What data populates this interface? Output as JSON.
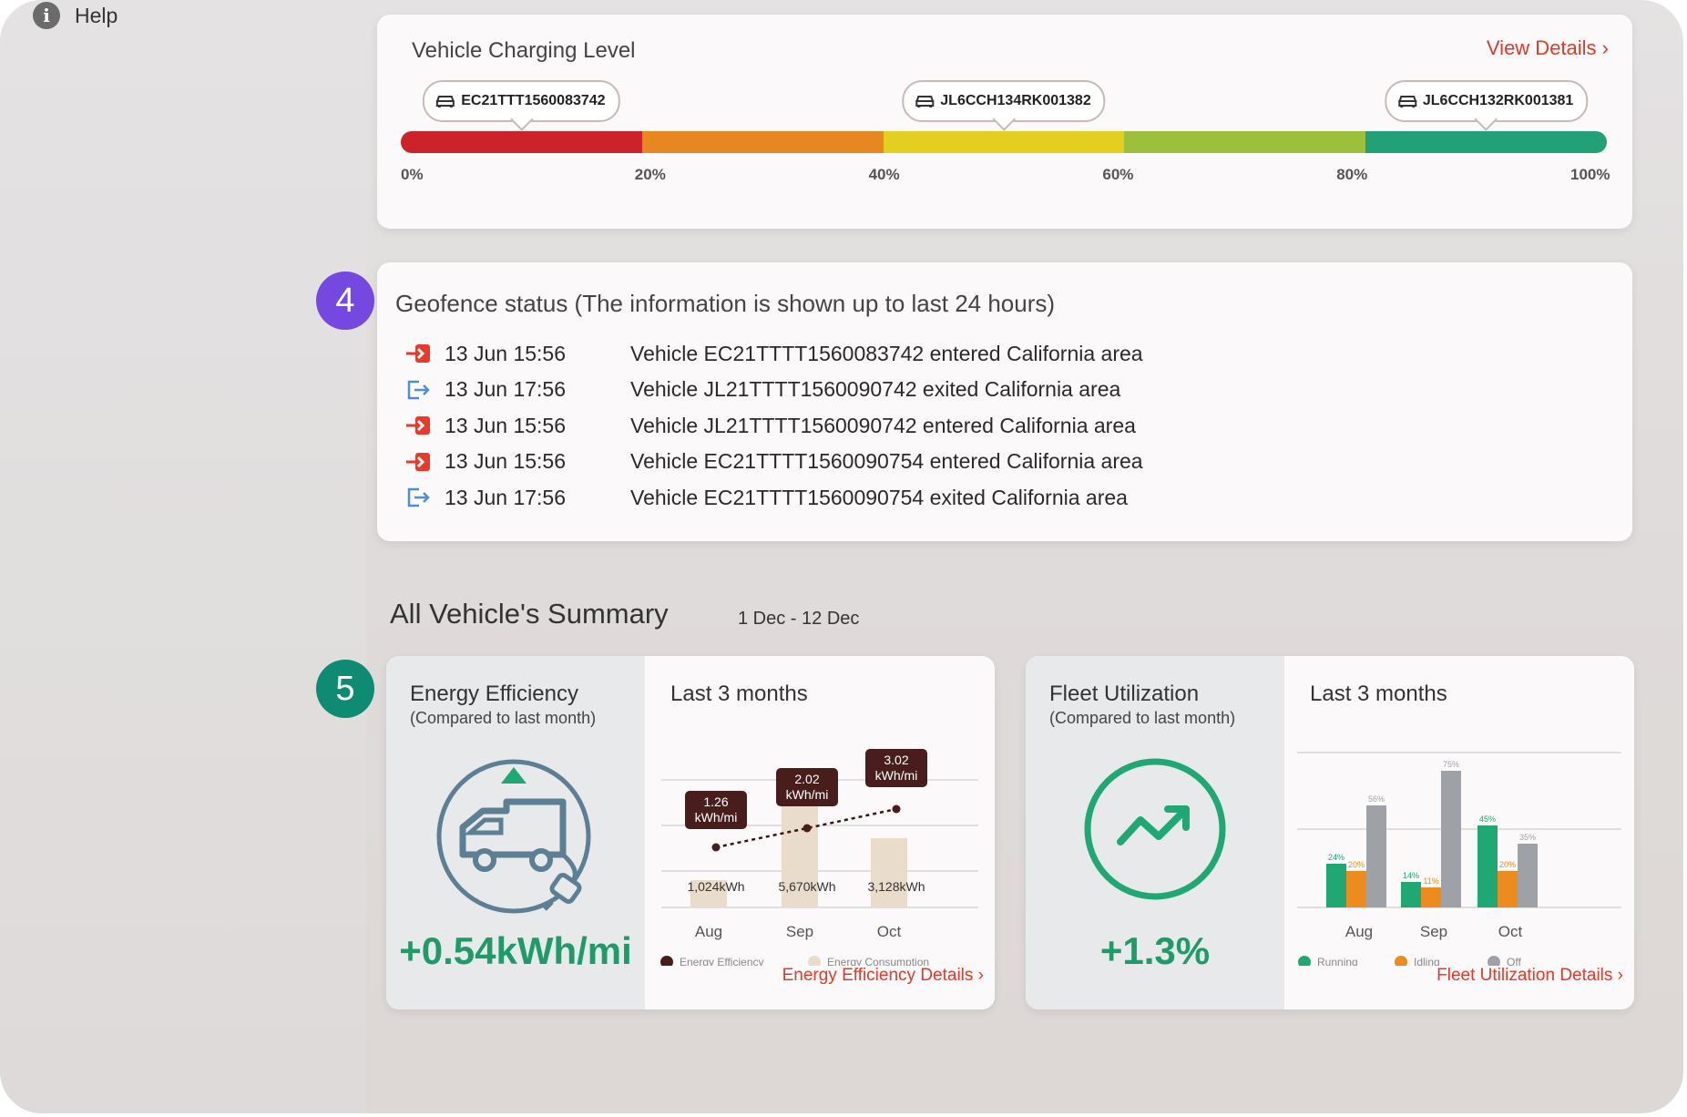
{
  "sidebar": {
    "help_label": "Help"
  },
  "charging": {
    "title": "Vehicle Charging Level",
    "view_details": "View Details ›",
    "ticks": [
      "0%",
      "20%",
      "40%",
      "60%",
      "80%",
      "100%"
    ],
    "segment_colors": [
      "#cc2229",
      "#e8861f",
      "#e4cf20",
      "#9cc03c",
      "#22a078"
    ],
    "vehicles": [
      {
        "id": "EC21TTT1560083742",
        "level_pct": 10
      },
      {
        "id": "JL6CCH134RK001382",
        "level_pct": 50
      },
      {
        "id": "JL6CCH132RK001381",
        "level_pct": 90
      }
    ]
  },
  "geofence": {
    "badge": "4",
    "title": "Geofence status (The information is shown up to last 24 hours)",
    "events": [
      {
        "type": "enter",
        "time": "13 Jun 15:56",
        "text": "Vehicle EC21TTTT1560083742 entered California area"
      },
      {
        "type": "exit",
        "time": "13 Jun 17:56",
        "text": "Vehicle JL21TTTT1560090742 exited California area"
      },
      {
        "type": "enter",
        "time": "13 Jun 15:56",
        "text": "Vehicle JL21TTTT1560090742 entered California area"
      },
      {
        "type": "enter",
        "time": "13 Jun 15:56",
        "text": "Vehicle EC21TTTT1560090754 entered California area"
      },
      {
        "type": "exit",
        "time": "13 Jun 17:56",
        "text": "Vehicle EC21TTTT1560090754 exited California area"
      }
    ]
  },
  "summary": {
    "badge": "5",
    "title": "All Vehicle's Summary",
    "range": "1 Dec - 12 Dec"
  },
  "energy": {
    "title": "Energy Efficiency",
    "subtitle": "(Compared to last month)",
    "value": "+0.54kWh/mi",
    "months_label": "Last 3 months",
    "details_link": "Energy Efficiency Details ›",
    "chart_data": {
      "type": "bar",
      "categories": [
        "Aug",
        "Sep",
        "Oct"
      ],
      "series": [
        {
          "name": "Energy Consumption",
          "values": [
            1024,
            5670,
            3128
          ],
          "labels": [
            "1,024kWh",
            "5,670kWh",
            "3,128kWh"
          ],
          "color": "#e9dccb"
        },
        {
          "name": "Energy Efficiency",
          "values": [
            1.26,
            2.02,
            3.02
          ],
          "labels": [
            "1.26 kWh/mi",
            "2.02 kWh/mi",
            "3.02 kWh/mi"
          ],
          "color": "#4a1d1d"
        }
      ]
    }
  },
  "fleet": {
    "title": "Fleet Utilization",
    "subtitle": "(Compared to last month)",
    "value": "+1.3%",
    "months_label": "Last 3 months",
    "details_link": "Fleet Utilization Details ›",
    "chart_data": {
      "type": "bar",
      "categories": [
        "Aug",
        "Sep",
        "Oct"
      ],
      "ylim": [
        0,
        80
      ],
      "series": [
        {
          "name": "Running",
          "values": [
            24,
            14,
            45
          ],
          "color": "#1fa874"
        },
        {
          "name": "Idling",
          "values": [
            20,
            11,
            20
          ],
          "color": "#ee8b1f"
        },
        {
          "name": "Off",
          "values": [
            56,
            75,
            35
          ],
          "color": "#9ea2a6"
        }
      ]
    }
  }
}
